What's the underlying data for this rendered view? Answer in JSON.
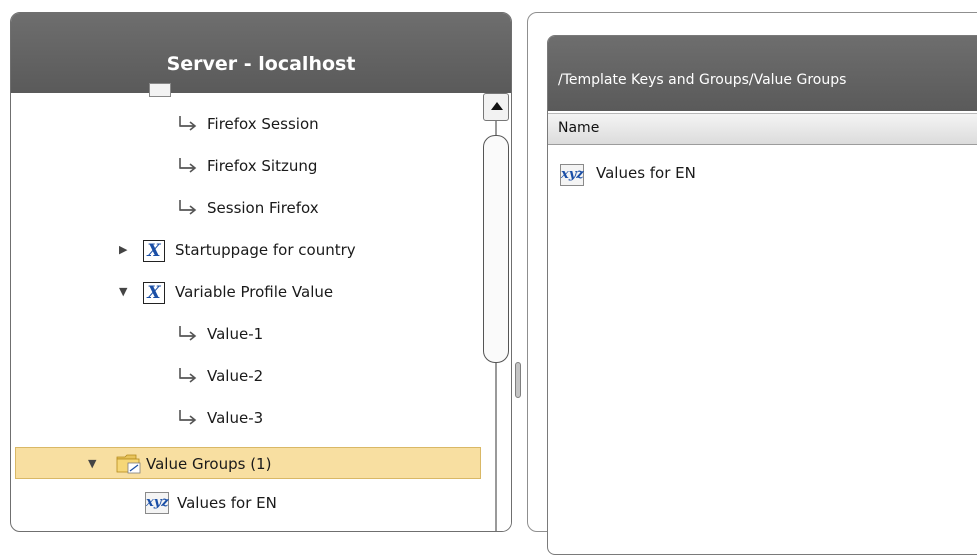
{
  "left_panel": {
    "title": "Server - localhost",
    "tree": [
      {
        "label": "Firefox Session",
        "icon": "value-arrow-icon"
      },
      {
        "label": "Firefox Sitzung",
        "icon": "value-arrow-icon"
      },
      {
        "label": "Session Firefox",
        "icon": "value-arrow-icon"
      },
      {
        "label": "Startuppage for country",
        "icon": "variable-x-icon",
        "expanded": false
      },
      {
        "label": "Variable Profile Value",
        "icon": "variable-x-icon",
        "expanded": true
      },
      {
        "label": "Value-1",
        "icon": "value-arrow-icon"
      },
      {
        "label": "Value-2",
        "icon": "value-arrow-icon"
      },
      {
        "label": "Value-3",
        "icon": "value-arrow-icon"
      },
      {
        "label": "Value Groups (1)",
        "icon": "value-group-folder-icon",
        "expanded": true,
        "selected": true
      },
      {
        "label": "Values for EN",
        "icon": "xyz-values-icon"
      }
    ],
    "icon_glyphs": {
      "variable": "X",
      "values": "xyz"
    }
  },
  "right_panel": {
    "path": "/Template Keys and Groups/Value Groups",
    "column_header": "Name",
    "rows": [
      {
        "label": "Values for EN",
        "icon": "xyz-values-icon"
      }
    ]
  },
  "colors": {
    "header_bg": "#5e5e5e",
    "selection_bg": "#f8dfa1",
    "icon_blue": "#1b4fa6"
  }
}
